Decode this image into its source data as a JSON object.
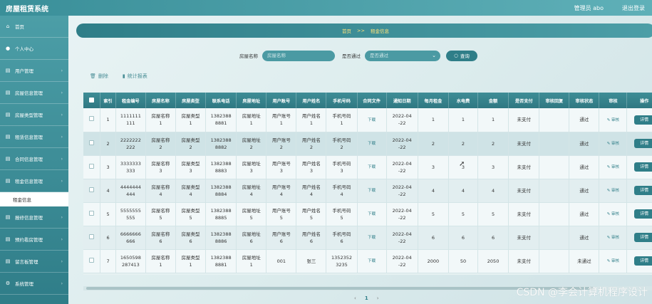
{
  "app": {
    "title": "房屋租赁系统",
    "user_label": "管理员 abo",
    "logout_label": "退出登录"
  },
  "sidebar": {
    "items": [
      {
        "label": "首页",
        "icon": "home-icon",
        "glyph": "⌂"
      },
      {
        "label": "个人中心",
        "icon": "user-icon",
        "glyph": "●"
      },
      {
        "label": "用户管理",
        "icon": "users-icon",
        "glyph": "▤"
      },
      {
        "label": "房屋信息管理",
        "icon": "house-icon",
        "glyph": "▤"
      },
      {
        "label": "房屋类型管理",
        "icon": "category-icon",
        "glyph": "▤"
      },
      {
        "label": "租赁信息管理",
        "icon": "lease-icon",
        "glyph": "▤"
      },
      {
        "label": "合同信息管理",
        "icon": "contract-icon",
        "glyph": "▤"
      },
      {
        "label": "租金信息管理",
        "icon": "rent-icon",
        "glyph": "▤"
      },
      {
        "label": "报修信息管理",
        "icon": "repair-icon",
        "glyph": "▤"
      },
      {
        "label": "预约看房管理",
        "icon": "appointment-icon",
        "glyph": "▤"
      },
      {
        "label": "留言板管理",
        "icon": "message-icon",
        "glyph": "▤"
      },
      {
        "label": "系统管理",
        "icon": "settings-icon",
        "glyph": "⚙"
      }
    ],
    "sub_item": "租金信息"
  },
  "breadcrumb": {
    "home": "首页",
    "sep": ">>",
    "current": "租金信息"
  },
  "search": {
    "name_label": "房屋名称",
    "name_placeholder": "房屋名称",
    "approved_label": "是否通过",
    "approved_value": "是否通过",
    "search_button": "查询"
  },
  "toolbar": {
    "delete_label": "删除",
    "report_label": "统计报表"
  },
  "table": {
    "headers": [
      "",
      "索引",
      "租金编号",
      "房屋名称",
      "房屋类型",
      "联系电话",
      "房屋地址",
      "用户账号",
      "用户姓名",
      "手机号码",
      "合同文件",
      "通知日期",
      "每月租金",
      "水电费",
      "金额",
      "是否支付",
      "审核回复",
      "审核状态",
      "审核",
      "操作"
    ],
    "rows": [
      [
        "",
        "1",
        "1111111\n111",
        "房屋名称\n1",
        "房屋类型\n1",
        "1382388\n8881",
        "房屋地址\n1",
        "用户账号\n1",
        "用户姓名\n1",
        "手机号码\n1",
        "下载",
        "2022-04\n-22",
        "1",
        "1",
        "1",
        "未支付",
        "",
        "通过",
        "审核",
        "详情"
      ],
      [
        "",
        "2",
        "2222222\n222",
        "房屋名称\n2",
        "房屋类型\n2",
        "1382388\n8882",
        "房屋地址\n2",
        "用户账号\n2",
        "用户姓名\n2",
        "手机号码\n2",
        "下载",
        "2022-04\n-22",
        "2",
        "2",
        "2",
        "未支付",
        "",
        "通过",
        "审核",
        "详情"
      ],
      [
        "",
        "3",
        "3333333\n333",
        "房屋名称\n3",
        "房屋类型\n3",
        "1382388\n8883",
        "房屋地址\n3",
        "用户账号\n3",
        "用户姓名\n3",
        "手机号码\n3",
        "下载",
        "2022-04\n-22",
        "3",
        "3",
        "3",
        "未支付",
        "",
        "通过",
        "审核",
        "详情"
      ],
      [
        "",
        "4",
        "4444444\n444",
        "房屋名称\n4",
        "房屋类型\n4",
        "1382388\n8884",
        "房屋地址\n4",
        "用户账号\n4",
        "用户姓名\n4",
        "手机号码\n4",
        "下载",
        "2022-04\n-22",
        "4",
        "4",
        "4",
        "未支付",
        "",
        "通过",
        "审核",
        "详情"
      ],
      [
        "",
        "5",
        "5555555\n555",
        "房屋名称\n5",
        "房屋类型\n5",
        "1382388\n8885",
        "房屋地址\n5",
        "用户账号\n5",
        "用户姓名\n5",
        "手机号码\n5",
        "下载",
        "2022-04\n-22",
        "5",
        "5",
        "5",
        "未支付",
        "",
        "通过",
        "审核",
        "详情"
      ],
      [
        "",
        "6",
        "6666666\n666",
        "房屋名称\n6",
        "房屋类型\n6",
        "1382388\n8886",
        "房屋地址\n6",
        "用户账号\n6",
        "用户姓名\n6",
        "手机号码\n6",
        "下载",
        "2022-04\n-22",
        "6",
        "6",
        "6",
        "未支付",
        "",
        "通过",
        "审核",
        "详情"
      ],
      [
        "",
        "7",
        "1650598\n287413",
        "房屋名称\n1",
        "房屋类型\n1",
        "1382388\n8881",
        "房屋地址\n1",
        "001",
        "张三",
        "1352352\n3235",
        "下载",
        "2022-04\n-22",
        "2000",
        "50",
        "2050",
        "未支付",
        "",
        "未通过",
        "审核",
        "详情"
      ]
    ]
  },
  "pagination": {
    "prev": "‹",
    "current": "1",
    "next": "›"
  },
  "watermark": "CSDN @李会计算机程序设计"
}
